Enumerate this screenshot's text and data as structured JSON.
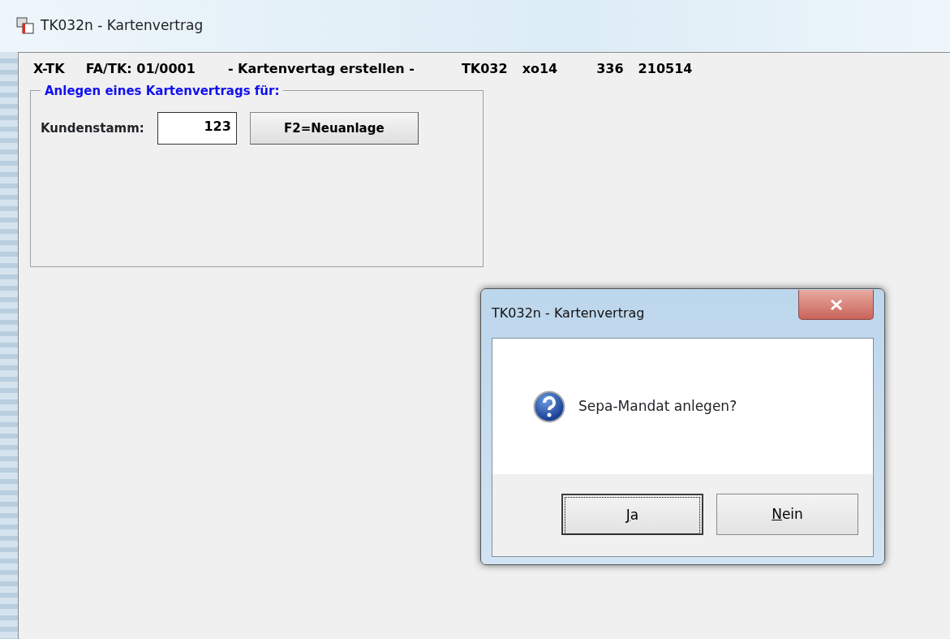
{
  "window": {
    "title": "TK032n - Kartenvertrag"
  },
  "header": [
    "X-TK",
    "FA/TK: 01/0001",
    "- Kartenvertag erstellen -",
    "TK032",
    "xo14",
    "336",
    "210514"
  ],
  "group": {
    "title": "Anlegen eines Kartenvertrags für:",
    "label": "Kundenstamm:",
    "value": "123",
    "button": "F2=Neuanlage"
  },
  "dialog": {
    "title": "TK032n - Kartenvertrag",
    "message": "Sepa-Mandat anlegen?",
    "buttons": [
      {
        "label": "Ja",
        "focused": true,
        "mnemonic": true
      },
      {
        "label": "Nein",
        "focused": false,
        "mnemonic": true
      }
    ]
  }
}
